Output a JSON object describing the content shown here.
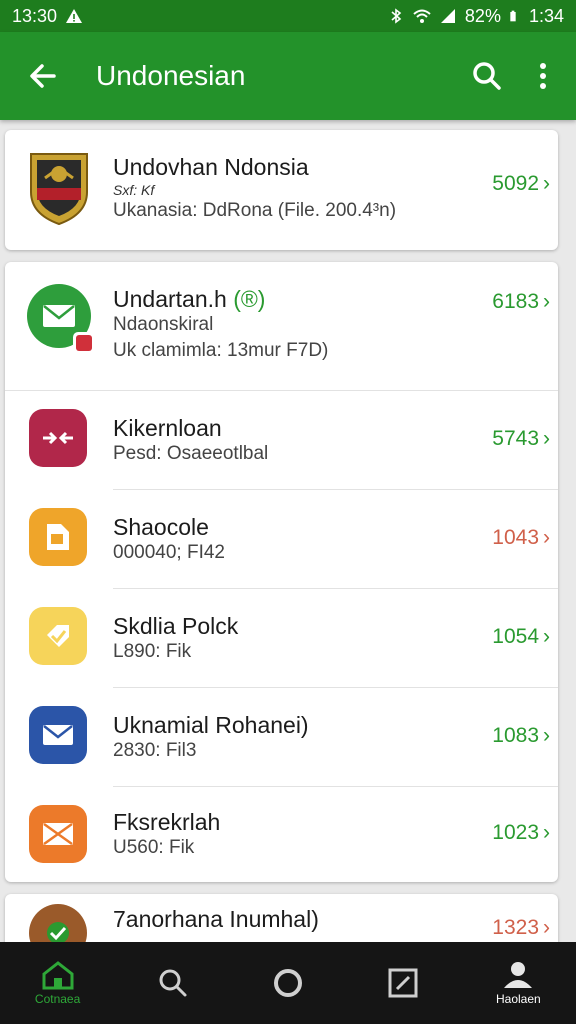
{
  "status_bar": {
    "left_time": "13:30",
    "battery": "82%",
    "right_time": "1:34"
  },
  "app_bar": {
    "title": "Undonesian"
  },
  "featured": {
    "title": "Undovhan Ndonsia",
    "subtitle_small": "Sxf: Kf",
    "detail": "Ukanasia: DdRona (File. 200.4³n)",
    "value": "5092"
  },
  "list_items": [
    {
      "title": "Undartan.h",
      "title_badge": "(®)",
      "subtitle": "Ndaonskiral",
      "detail": "Uk clamimla: 13mur F7D)",
      "value": "6183",
      "value_color": "green",
      "icon": "mail-icon",
      "icon_bg": "#2e9e3c"
    },
    {
      "title": "Kikernloan",
      "subtitle": "Pesd: Osaeeotlbal",
      "value": "5743",
      "value_color": "green",
      "icon": "share-arrows-icon",
      "icon_bg": "#b1274a"
    },
    {
      "title": "Shaocole",
      "subtitle": "000040; FI42",
      "value": "1043",
      "value_color": "red",
      "icon": "document-icon",
      "icon_bg": "#efa52a"
    },
    {
      "title": "Skdlia Polck",
      "subtitle": "L890: Fik",
      "value": "1054",
      "value_color": "green",
      "icon": "tag-icon",
      "icon_bg": "#f6d45a"
    },
    {
      "title": "Uknamial Rohanei)",
      "subtitle": "2830: Fil3",
      "value": "1083",
      "value_color": "green",
      "icon": "envelope-icon",
      "icon_bg": "#2b55a8"
    },
    {
      "title": "Fksrekrlah",
      "subtitle": "U560: Fik",
      "value": "1023",
      "value_color": "green",
      "icon": "envelope-open-icon",
      "icon_bg": "#ec7a2a"
    }
  ],
  "partial_item": {
    "title": "7anorhana Inumhal)",
    "value": "1323",
    "value_color": "red",
    "icon": "check-icon",
    "icon_bg": "#9a5a2a"
  },
  "bottom_nav": [
    {
      "label": "Cotnaea",
      "icon": "home-icon",
      "active": true
    },
    {
      "label": "",
      "icon": "search-icon",
      "active": false
    },
    {
      "label": "",
      "icon": "circle-icon",
      "active": false
    },
    {
      "label": "",
      "icon": "edit-icon",
      "active": false
    },
    {
      "label": "Haolaen",
      "icon": "profile-icon",
      "active": false
    }
  ],
  "colors": {
    "primary": "#23922a",
    "status_bar": "#1e7d1e",
    "value_green": "#2a9a30",
    "value_red": "#d0604a"
  }
}
